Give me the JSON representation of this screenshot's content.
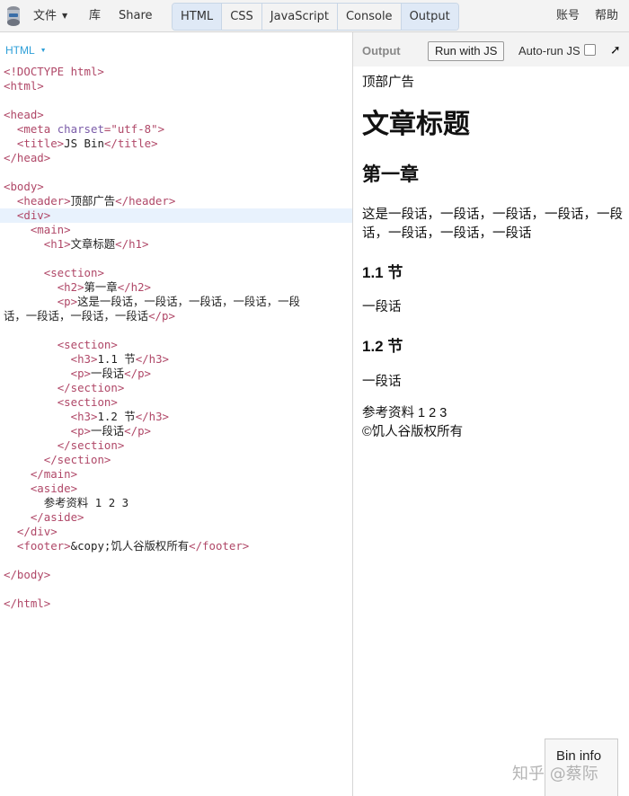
{
  "topbar": {
    "file_label": "文件",
    "library_label": "库",
    "share_label": "Share",
    "tabs": [
      {
        "label": "HTML",
        "active": true
      },
      {
        "label": "CSS",
        "active": false
      },
      {
        "label": "JavaScript",
        "active": false
      },
      {
        "label": "Console",
        "active": false
      },
      {
        "label": "Output",
        "active": true
      }
    ],
    "account_label": "账号",
    "help_label": "帮助"
  },
  "editor": {
    "language_label": "HTML",
    "code_lines": [
      [
        [
          "tag",
          "<!DOCTYPE html>"
        ]
      ],
      [
        [
          "tag",
          "<html>"
        ]
      ],
      [],
      [
        [
          "tag",
          "<head>"
        ]
      ],
      [
        [
          "txt",
          "  "
        ],
        [
          "tag",
          "<meta "
        ],
        [
          "attr",
          "charset"
        ],
        [
          "tag",
          "="
        ],
        [
          "str",
          "\"utf-8\""
        ],
        [
          "tag",
          ">"
        ]
      ],
      [
        [
          "txt",
          "  "
        ],
        [
          "tag",
          "<title>"
        ],
        [
          "txt",
          "JS Bin"
        ],
        [
          "tag",
          "</title>"
        ]
      ],
      [
        [
          "tag",
          "</head>"
        ]
      ],
      [],
      [
        [
          "tag",
          "<body>"
        ]
      ],
      [
        [
          "txt",
          "  "
        ],
        [
          "tag",
          "<header>"
        ],
        [
          "txt",
          "顶部广告"
        ],
        [
          "tag",
          "</header>"
        ]
      ],
      [
        [
          "txt",
          "  "
        ],
        [
          "tag",
          "<div>"
        ]
      ],
      [
        [
          "txt",
          "    "
        ],
        [
          "tag",
          "<main>"
        ]
      ],
      [
        [
          "txt",
          "      "
        ],
        [
          "tag",
          "<h1>"
        ],
        [
          "txt",
          "文章标题"
        ],
        [
          "tag",
          "</h1>"
        ]
      ],
      [],
      [
        [
          "txt",
          "      "
        ],
        [
          "tag",
          "<section>"
        ]
      ],
      [
        [
          "txt",
          "        "
        ],
        [
          "tag",
          "<h2>"
        ],
        [
          "txt",
          "第一章"
        ],
        [
          "tag",
          "</h2>"
        ]
      ],
      [
        [
          "txt",
          "        "
        ],
        [
          "tag",
          "<p>"
        ],
        [
          "txt",
          "这是一段话，一段话，一段话，一段话，一段"
        ]
      ],
      [
        [
          "txt",
          "话，一段话，一段话，一段话"
        ],
        [
          "tag",
          "</p>"
        ]
      ],
      [],
      [
        [
          "txt",
          "        "
        ],
        [
          "tag",
          "<section>"
        ]
      ],
      [
        [
          "txt",
          "          "
        ],
        [
          "tag",
          "<h3>"
        ],
        [
          "txt",
          "1.1 节"
        ],
        [
          "tag",
          "</h3>"
        ]
      ],
      [
        [
          "txt",
          "          "
        ],
        [
          "tag",
          "<p>"
        ],
        [
          "txt",
          "一段话"
        ],
        [
          "tag",
          "</p>"
        ]
      ],
      [
        [
          "txt",
          "        "
        ],
        [
          "tag",
          "</section>"
        ]
      ],
      [
        [
          "txt",
          "        "
        ],
        [
          "tag",
          "<section>"
        ]
      ],
      [
        [
          "txt",
          "          "
        ],
        [
          "tag",
          "<h3>"
        ],
        [
          "txt",
          "1.2 节"
        ],
        [
          "tag",
          "</h3>"
        ]
      ],
      [
        [
          "txt",
          "          "
        ],
        [
          "tag",
          "<p>"
        ],
        [
          "txt",
          "一段话"
        ],
        [
          "tag",
          "</p>"
        ]
      ],
      [
        [
          "txt",
          "        "
        ],
        [
          "tag",
          "</section>"
        ]
      ],
      [
        [
          "txt",
          "      "
        ],
        [
          "tag",
          "</section>"
        ]
      ],
      [
        [
          "txt",
          "    "
        ],
        [
          "tag",
          "</main>"
        ]
      ],
      [
        [
          "txt",
          "    "
        ],
        [
          "tag",
          "<aside>"
        ]
      ],
      [
        [
          "txt",
          "      参考资料 1 2 3"
        ]
      ],
      [
        [
          "txt",
          "    "
        ],
        [
          "tag",
          "</aside>"
        ]
      ],
      [
        [
          "txt",
          "  "
        ],
        [
          "tag",
          "</div>"
        ]
      ],
      [
        [
          "txt",
          "  "
        ],
        [
          "tag",
          "<footer>"
        ],
        [
          "txt",
          "&copy;饥人谷版权所有"
        ],
        [
          "tag",
          "</footer>"
        ]
      ],
      [],
      [
        [
          "tag",
          "</body>"
        ]
      ],
      [],
      [
        [
          "tag",
          "</html>"
        ]
      ]
    ],
    "highlighted_line": 10
  },
  "output": {
    "label": "Output",
    "run_button": "Run with JS",
    "autorun_label": "Auto-run JS",
    "autorun_checked": false,
    "popout_icon": "arrow-up-right-icon",
    "preview": {
      "header": "顶部广告",
      "h1": "文章标题",
      "h2": "第一章",
      "p1": "这是一段话，一段话，一段话，一段话，一段话，一段话，一段话，一段话",
      "h3_1": "1.1 节",
      "p2": "一段话",
      "h3_2": "1.2 节",
      "p3": "一段话",
      "aside": "参考资料 1 2 3",
      "footer": "©饥人谷版权所有"
    }
  },
  "bin_info": "Bin info",
  "watermark": "知乎 @蔡际"
}
